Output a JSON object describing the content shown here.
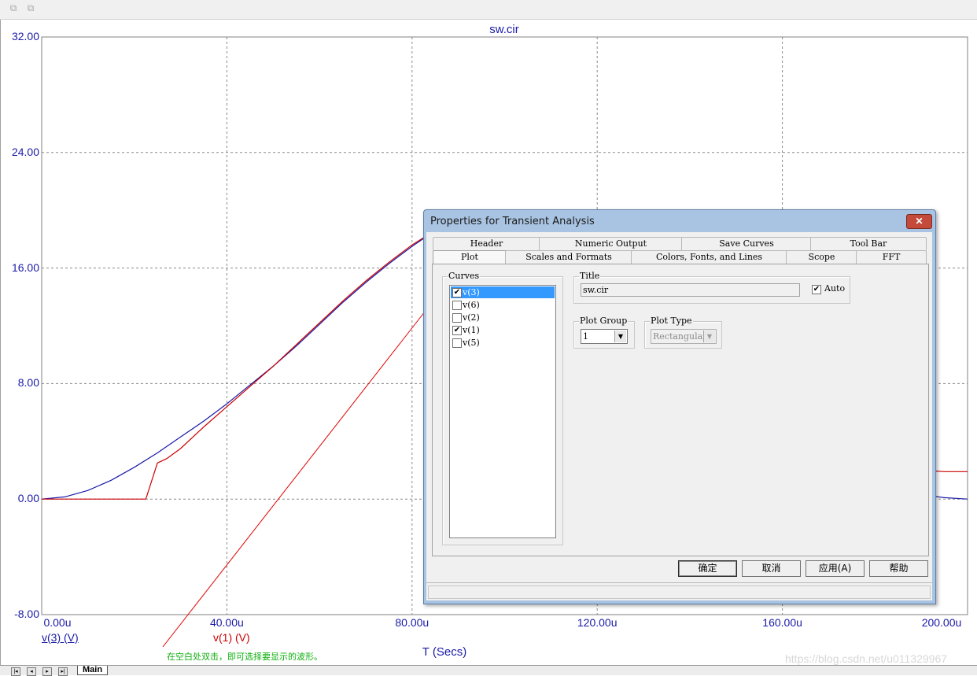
{
  "toolbar": {
    "icons": [
      "copy-icon",
      "paste-icon"
    ]
  },
  "plot": {
    "title": "sw.cir",
    "xlabel": "T (Secs)",
    "legend": [
      {
        "label": "v(3) (V)",
        "color": "#1a1aa8"
      },
      {
        "label": "v(1) (V)",
        "color": "#cc0000"
      }
    ],
    "note": "在空白处双击，即可选择要显示的波形。",
    "watermark": "https://blog.csdn.net/u011329967"
  },
  "chart_data": {
    "type": "line",
    "title": "sw.cir",
    "xlabel": "T (Secs)",
    "ylabel": "",
    "xlim": [
      0,
      200
    ],
    "ylim": [
      -8,
      32
    ],
    "x_ticks": [
      "0.00u",
      "40.00u",
      "80.00u",
      "120.00u",
      "160.00u",
      "200.00u"
    ],
    "y_ticks": [
      "32.00",
      "24.00",
      "16.00",
      "8.00",
      "0.00",
      "-8.00"
    ],
    "grid": true,
    "series": [
      {
        "name": "v(3) (V)",
        "color": "#1a1aa8",
        "x": [
          0,
          5,
          10,
          15,
          20,
          25,
          30,
          35,
          40,
          45,
          50,
          55,
          60,
          65,
          70,
          75,
          80,
          85,
          190,
          195,
          200
        ],
        "y": [
          0,
          0.15,
          0.6,
          1.3,
          2.2,
          3.2,
          4.3,
          5.4,
          6.6,
          7.9,
          9.2,
          10.6,
          12.1,
          13.6,
          15.0,
          16.3,
          17.5,
          18.6,
          0.3,
          0.1,
          0.0
        ]
      },
      {
        "name": "v(1) (V)",
        "color": "#cc0000",
        "x": [
          0,
          22.5,
          25,
          27,
          30,
          35,
          40,
          45,
          50,
          55,
          60,
          65,
          70,
          75,
          80,
          85,
          190,
          195,
          200
        ],
        "y": [
          0,
          0,
          2.5,
          2.8,
          3.5,
          5.0,
          6.4,
          7.8,
          9.2,
          10.7,
          12.2,
          13.7,
          15.1,
          16.4,
          17.6,
          18.6,
          2.0,
          1.9,
          1.9
        ]
      }
    ]
  },
  "sheet": {
    "tab_label": "Main",
    "nav_buttons": [
      "|◂",
      "◂",
      "▸",
      "▸|"
    ]
  },
  "dialog": {
    "title": "Properties for Transient Analysis",
    "close_label": "✕",
    "tabs_row1": [
      "Header",
      "Numeric Output",
      "Save Curves",
      "Tool Bar"
    ],
    "tabs_row2": [
      "Plot",
      "Scales and Formats",
      "Colors, Fonts, and Lines",
      "Scope",
      "FFT"
    ],
    "active_tab": "Plot",
    "curves": {
      "label": "Curves",
      "items": [
        {
          "label": "v(3)",
          "checked": true,
          "selected": true
        },
        {
          "label": "v(6)",
          "checked": false,
          "selected": false
        },
        {
          "label": "v(2)",
          "checked": false,
          "selected": false
        },
        {
          "label": "v(1)",
          "checked": true,
          "selected": false
        },
        {
          "label": "v(5)",
          "checked": false,
          "selected": false
        }
      ]
    },
    "title_group": {
      "label": "Title",
      "value": "sw.cir",
      "auto_label": "Auto",
      "auto_checked": true
    },
    "plot_group": {
      "label": "Plot Group",
      "value": "1"
    },
    "plot_type": {
      "label": "Plot Type",
      "value": "Rectangular"
    },
    "buttons": {
      "ok": "确定",
      "cancel": "取消",
      "apply": "应用(A)",
      "help": "帮助"
    }
  }
}
